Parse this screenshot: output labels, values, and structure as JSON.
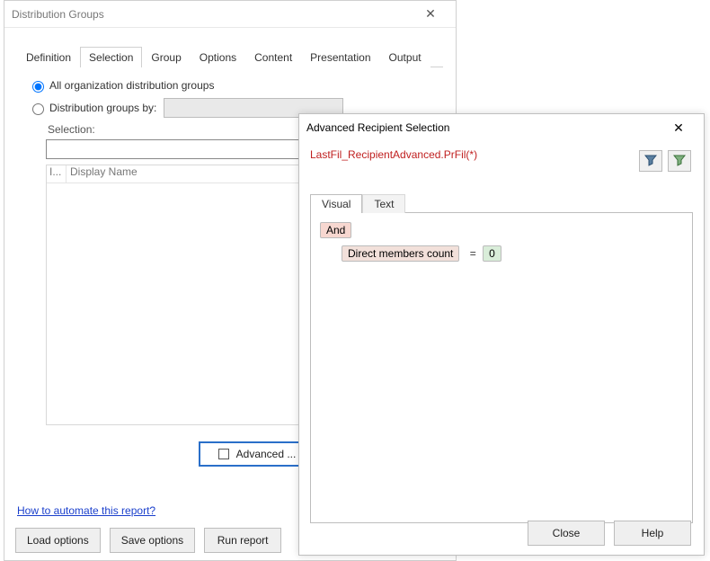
{
  "main": {
    "title": "Distribution Groups",
    "tabs": [
      "Definition",
      "Selection",
      "Group",
      "Options",
      "Content",
      "Presentation",
      "Output"
    ],
    "active_tab_index": 1,
    "radio_all": {
      "label": "All organization distribution groups",
      "checked": true
    },
    "radio_by": {
      "label": "Distribution groups by:",
      "checked": false
    },
    "selection_label": "Selection:",
    "grid": {
      "col_icon_header": "I...",
      "col_name_header": "Display Name"
    },
    "advanced_button": "Advanced ...",
    "automate_link": "How to automate this report?",
    "buttons": {
      "load": "Load options",
      "save": "Save options",
      "run": "Run report"
    }
  },
  "modal": {
    "title": "Advanced Recipient Selection",
    "filter_name": "LastFil_RecipientAdvanced.PrFil(*)",
    "toolbar_icons": [
      "filter-save-icon",
      "filter-clear-icon"
    ],
    "tabs": [
      "Visual",
      "Text"
    ],
    "active_tab_index": 0,
    "root_operator": "And",
    "condition": {
      "field": "Direct members count",
      "op": "=",
      "value": "0"
    },
    "buttons": {
      "close": "Close",
      "help": "Help"
    }
  }
}
